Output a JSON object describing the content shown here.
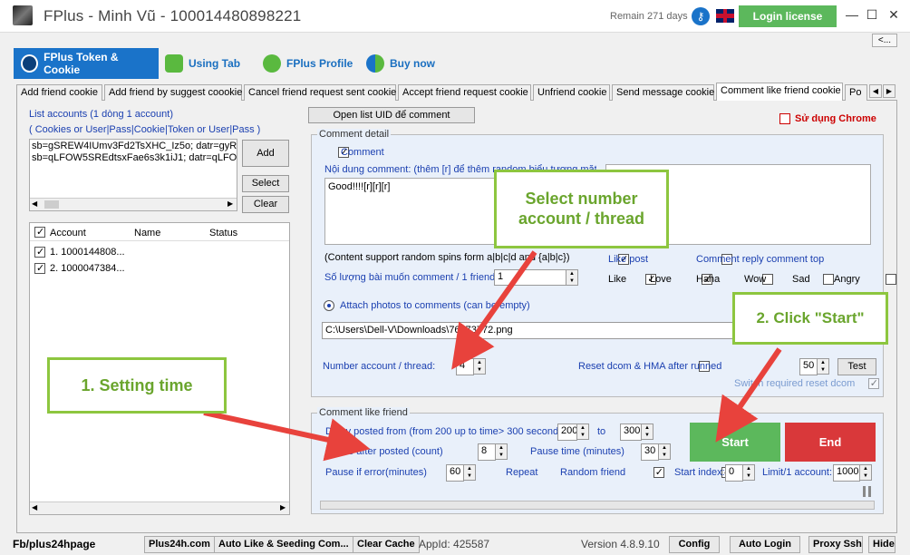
{
  "window": {
    "title": "FPlus - Minh Vũ - 100014480898221",
    "remain": "Remain 271 days",
    "login_label": "Login license",
    "minimize": "—",
    "maximize": "☐",
    "close": "✕",
    "collapse": "<..."
  },
  "main_tabs": [
    {
      "label": "FPlus Token & Cookie",
      "active": true
    },
    {
      "label": "Using Tab"
    },
    {
      "label": "FPlus Profile"
    },
    {
      "label": "Buy now"
    }
  ],
  "sub_tabs": [
    "Add friend cookie",
    "Add friend by suggest coookie",
    "Cancel friend request sent cookie",
    "Accept friend request cookie",
    "Unfriend cookie",
    "Send message cookie",
    "Comment like friend cookie",
    "Po"
  ],
  "left": {
    "list_label": "List accounts (1 dòng 1 account)",
    "format_label": "( Cookies or User|Pass|Cookie|Token or User|Pass )",
    "lines": [
      "sb=gSREW4IUmv3Fd2TsXHC_Iz5o; datr=gyRE",
      "sb=qLFOW5SREdtsxFae6s3k1iJ1; datr=qLFOW"
    ],
    "add": "Add",
    "select": "Select",
    "clear": "Clear",
    "columns": [
      "Account",
      "Name",
      "Status"
    ],
    "rows": [
      "1. 1000144808...",
      "2. 1000047384..."
    ]
  },
  "right": {
    "open_uid": "Open list UID để comment",
    "use_chrome": "Sử dụng Chrome",
    "comment_detail": "Comment detail",
    "comment": "Comment",
    "content_label": "Nội dung comment: (thêm [r] để thêm random biểu tượng mặt cười)",
    "content_value": "Good!!!![r][r][r]",
    "spin_support": "(Content support random spins form a|b|c|d and {a|b|c})",
    "like_post": "Like post",
    "comment_reply": "Comment reply comment top",
    "posts_per_friend_label": "Số lượng bài muốn comment / 1 friend",
    "posts_per_friend": "1",
    "reactions": [
      "Like",
      "Love",
      "Haha",
      "Wow",
      "Sad",
      "Angry"
    ],
    "attach": "Attach photos to comments (can be empty)",
    "path": "C:\\Users\\Dell-V\\Downloads\\76873772.png",
    "thread_label": "Number account / thread:",
    "thread": "4",
    "reset_dcom": "Reset dcom & HMA after runned",
    "reset_value": "50",
    "test": "Test",
    "switch_reset": "Switch required reset dcom",
    "like_friend": "Comment like friend",
    "delay_label": "Delay posted from (from 200 up to time> 300 seconds)",
    "delay_from": "200",
    "to": "to",
    "delay_to": "300",
    "pause_posted_label": "Pause after posted (count)",
    "pause_posted": "8",
    "pause_time_label": "Pause time (minutes)",
    "pause_time": "30",
    "pause_error_label": "Pause if error(minutes)",
    "pause_error": "60",
    "repeat": "Repeat",
    "random_friend": "Random friend",
    "start_index_label": "Start index:",
    "start_index": "0",
    "limit_label": "Limit/1 account:",
    "limit": "1000",
    "start": "Start",
    "end": "End"
  },
  "callouts": {
    "select_thread": "Select number account / thread",
    "click_start": "2. Click \"Start\"",
    "setting_time": "1. Setting time"
  },
  "bottom": {
    "site": "Fb/plus24hpage",
    "btn1": "Plus24h.com",
    "btn2": "Auto Like & Seeding Com...",
    "btn3": "Clear Cache",
    "appid": "AppId: 425587",
    "version": "Version 4.8.9.10",
    "btn4": "Config",
    "btn5": "Auto Login",
    "btn6": "Proxy Ssh",
    "btn7": "Hide"
  },
  "colors": {
    "accent": "#1a73c9",
    "start": "#5cb85c",
    "end": "#d9383a",
    "callout_border": "#8dc63f",
    "arrow": "#e8423c"
  }
}
